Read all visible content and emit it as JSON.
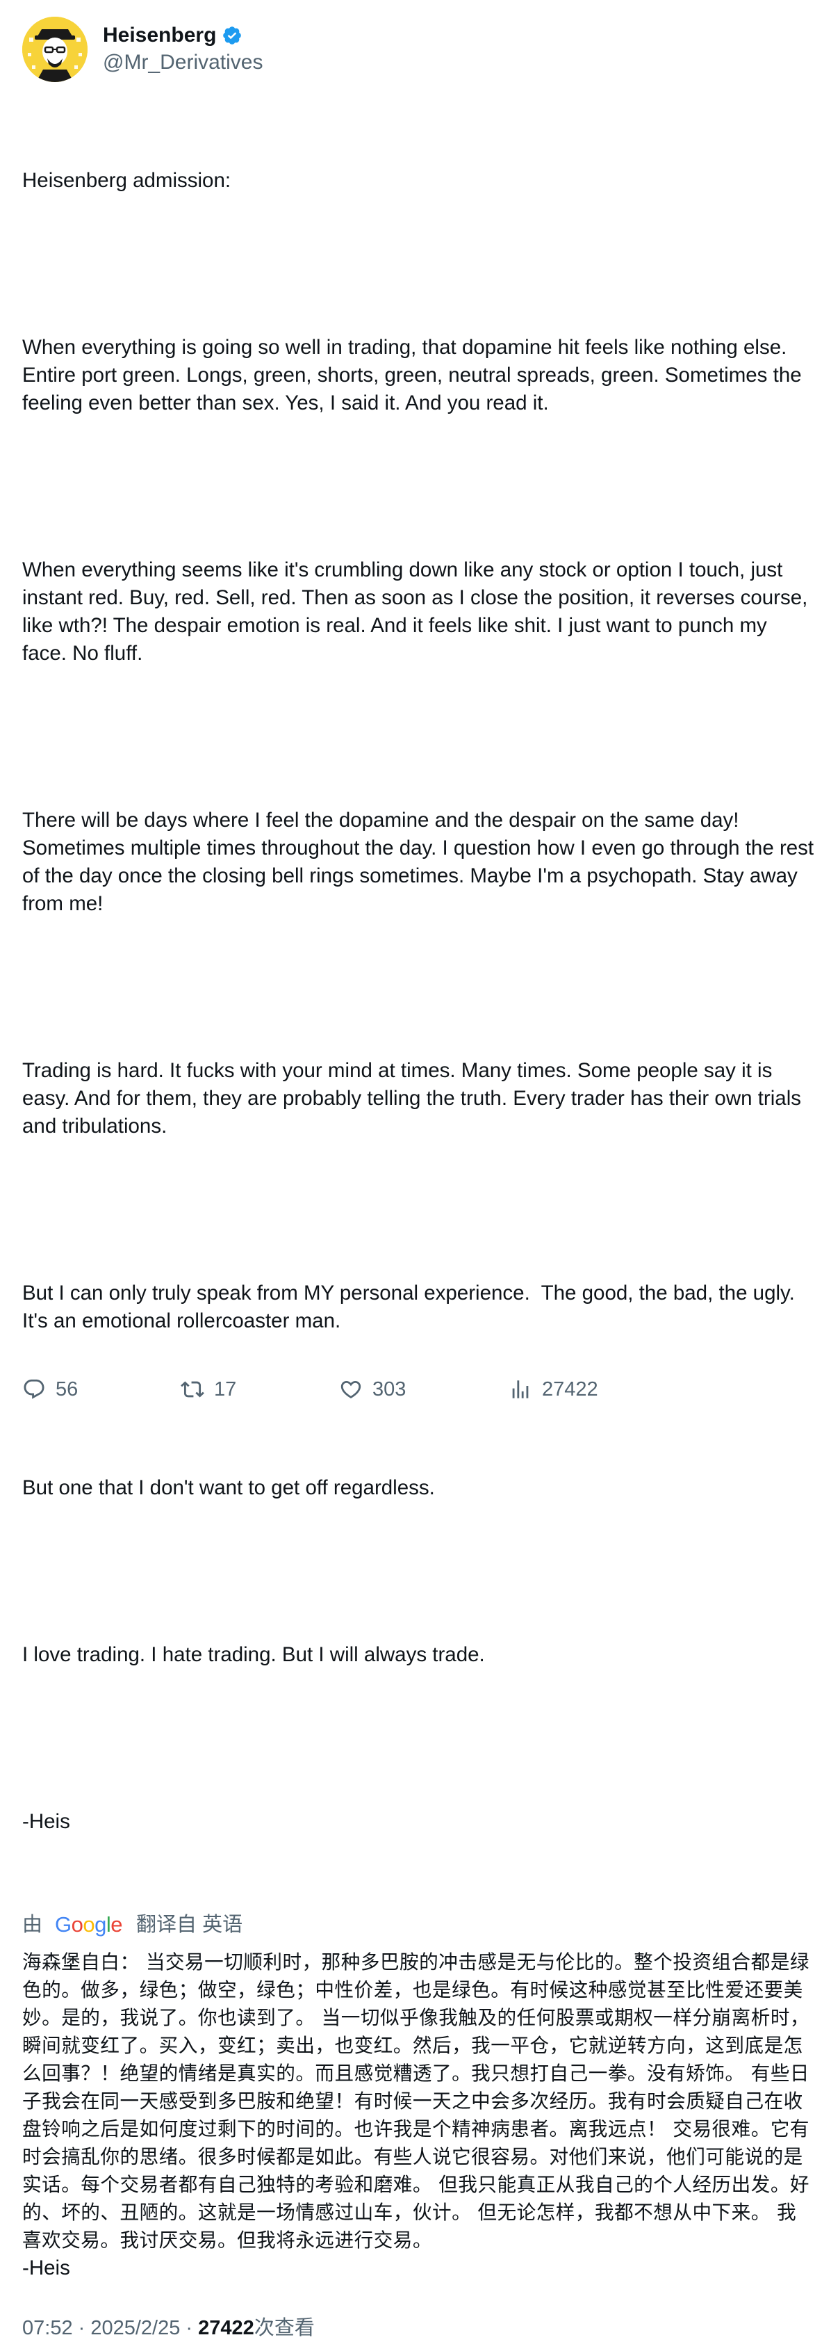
{
  "author": {
    "display_name": "Heisenberg",
    "handle": "@Mr_Derivatives",
    "verified": true,
    "avatar_icon": "heisenberg-avatar-icon",
    "avatar_bg": "#f7d33a"
  },
  "tweet": {
    "paragraphs": [
      "Heisenberg admission:",
      "When everything is going so well in trading, that dopamine hit feels like nothing else. Entire port green. Longs, green, shorts, green, neutral spreads, green. Sometimes the feeling even better than sex. Yes, I said it. And you read it.",
      "When everything seems like it's crumbling down like any stock or option I touch, just instant red. Buy, red. Sell, red. Then as soon as I close the position, it reverses course, like wth?! The despair emotion is real. And it feels like shit. I just want to punch my face. No fluff.",
      "There will be days where I feel the dopamine and the despair on the same day! Sometimes multiple times throughout the day. I question how I even go through the rest of the day once the closing bell rings sometimes. Maybe I'm a psychopath. Stay away from me!",
      "Trading is hard. It fucks with your mind at times. Many times. Some people say it is easy. And for them, they are probably telling the truth. Every trader has their own trials and tribulations.",
      "But I can only truly speak from MY personal experience.  The good, the bad, the ugly. It's an emotional rollercoaster man.",
      "But one that I don't want to get off regardless.",
      "I love trading. I hate trading. But I will always trade.",
      "-Heis"
    ]
  },
  "translation": {
    "by_label": "由",
    "provider": "Google",
    "from_label": "翻译自 英语",
    "text": "海森堡自白： 当交易一切顺利时，那种多巴胺的冲击感是无与伦比的。整个投资组合都是绿色的。做多，绿色；做空，绿色；中性价差，也是绿色。有时候这种感觉甚至比性爱还要美妙。是的，我说了。你也读到了。 当一切似乎像我触及的任何股票或期权一样分崩离析时，瞬间就变红了。买入，变红；卖出，也变红。然后，我一平仓，它就逆转方向，这到底是怎么回事？！绝望的情绪是真实的。而且感觉糟透了。我只想打自己一拳。没有矫饰。 有些日子我会在同一天感受到多巴胺和绝望！有时候一天之中会多次经历。我有时会质疑自己在收盘铃响之后是如何度过剩下的时间的。也许我是个精神病患者。离我远点！ 交易很难。它有时会搞乱你的思绪。很多时候都是如此。有些人说它很容易。对他们来说，他们可能说的是实话。每个交易者都有自己独特的考验和磨难。 但我只能真正从我自己的个人经历出发。好的、坏的、丑陋的。这就是一场情感过山车，伙计。 但无论怎样，我都不想从中下来。 我喜欢交易。我讨厌交易。但我将永远进行交易。",
    "sign": "-Heis"
  },
  "meta": {
    "time": "07:52",
    "sep1": " · ",
    "date": "2025/2/25",
    "sep2": " · ",
    "views_count": "27422",
    "views_label": "次查看"
  },
  "actions": {
    "replies": "56",
    "retweets": "17",
    "likes": "303",
    "views": "27422"
  },
  "colors": {
    "text": "#0f1419",
    "secondary": "#536471",
    "verified": "#1d9bf0"
  }
}
